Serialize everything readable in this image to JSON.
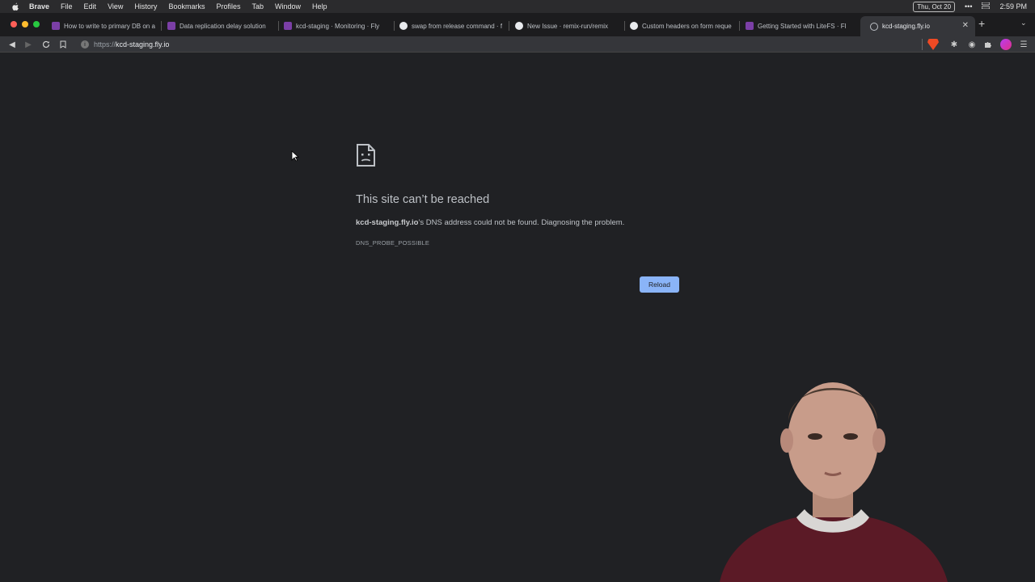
{
  "menubar": {
    "app_name": "Brave",
    "items": [
      "File",
      "Edit",
      "View",
      "History",
      "Bookmarks",
      "Profiles",
      "Tab",
      "Window",
      "Help"
    ],
    "date": "Thu, Oct 20",
    "time": "2:59 PM"
  },
  "tabs": [
    {
      "label": "How to write to primary DB on a",
      "icon": "fly-icon"
    },
    {
      "label": "Data replication delay solution",
      "icon": "fly-icon"
    },
    {
      "label": "kcd-staging · Monitoring · Fly",
      "icon": "fly-icon"
    },
    {
      "label": "swap from release command · f",
      "icon": "github-icon"
    },
    {
      "label": "New Issue · remix-run/remix",
      "icon": "github-icon"
    },
    {
      "label": "Custom headers on form reque",
      "icon": "github-icon"
    },
    {
      "label": "Getting Started with LiteFS · Fl",
      "icon": "fly-icon"
    },
    {
      "label": "kcd-staging.fly.io",
      "icon": "globe-icon",
      "active": true
    }
  ],
  "address_bar": {
    "scheme": "https://",
    "host": "kcd-staging.fly.io"
  },
  "error_page": {
    "title": "This site can’t be reached",
    "host_bold": "kcd-staging.fly.io",
    "message_rest": "’s DNS address could not be found. Diagnosing the problem.",
    "error_code": "DNS_PROBE_POSSIBLE",
    "reload_label": "Reload"
  },
  "colors": {
    "page_bg": "#202124",
    "accent": "#8ab4f8",
    "toolbar_bg": "#35363a"
  }
}
